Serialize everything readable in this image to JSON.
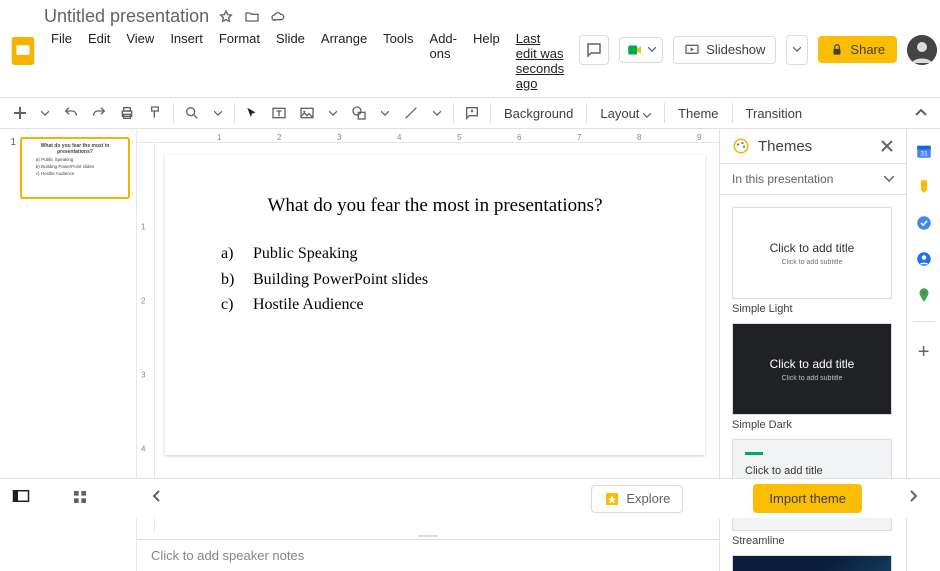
{
  "doc": {
    "title": "Untitled presentation",
    "last_edit": "Last edit was seconds ago"
  },
  "menus": [
    "File",
    "Edit",
    "View",
    "Insert",
    "Format",
    "Slide",
    "Arrange",
    "Tools",
    "Add-ons",
    "Help"
  ],
  "topbar": {
    "slideshow": "Slideshow",
    "share": "Share"
  },
  "toolbar": {
    "background": "Background",
    "layout": "Layout",
    "theme": "Theme",
    "transition": "Transition"
  },
  "ruler_h": [
    1,
    2,
    3,
    4,
    5,
    6,
    7,
    8,
    9
  ],
  "ruler_v": [
    1,
    2,
    3,
    4
  ],
  "thumb": {
    "num": "1"
  },
  "slide": {
    "question": "What do you fear the most in presentations?",
    "items": [
      {
        "letter": "a)",
        "text": "Public Speaking"
      },
      {
        "letter": "b)",
        "text": "Building PowerPoint slides"
      },
      {
        "letter": "c)",
        "text": "Hostile Audience"
      }
    ]
  },
  "notes": {
    "placeholder": "Click to add speaker notes"
  },
  "themes": {
    "title": "Themes",
    "section": "In this presentation",
    "preview_title": "Click to add title",
    "preview_sub": "Click to add subtitle",
    "items": [
      "Simple Light",
      "Simple Dark",
      "Streamline"
    ]
  },
  "bottom": {
    "explore": "Explore",
    "import": "Import theme"
  }
}
